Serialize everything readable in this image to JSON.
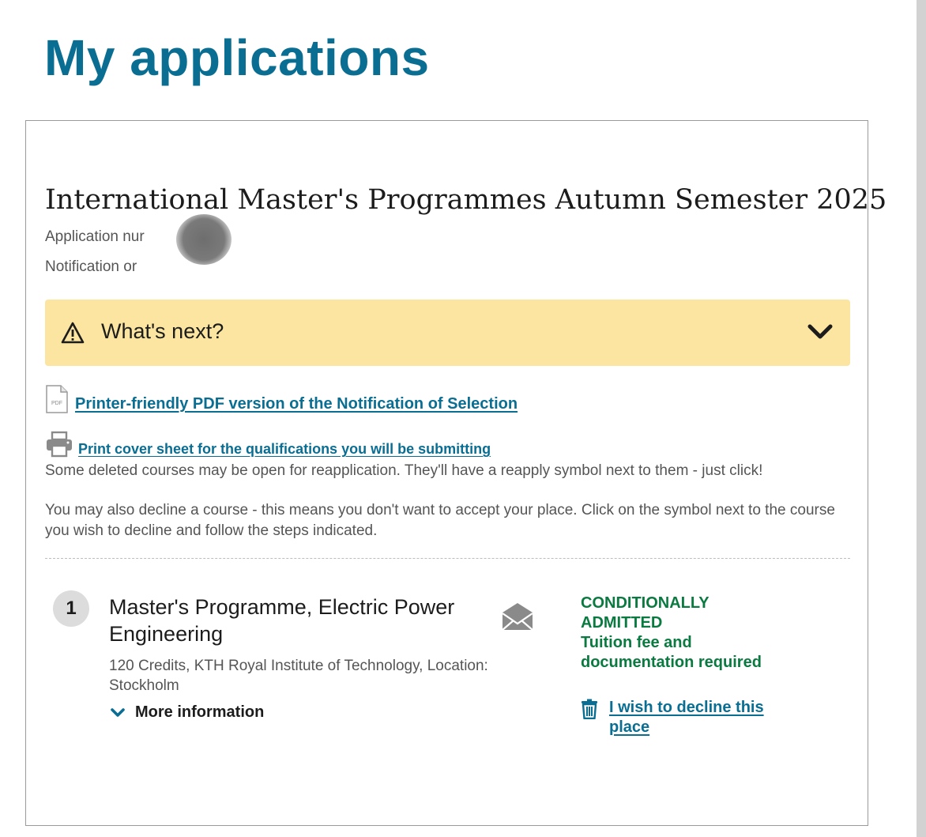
{
  "page": {
    "title": "My applications"
  },
  "application": {
    "round_title": "International Master's Programmes Autumn Semester 2025",
    "application_number_label": "Application nur",
    "notification_label": "Notification or",
    "whats_next": {
      "label": "What's next?",
      "expanded": false
    },
    "links": {
      "pdf_icon_text": "PDF",
      "pdf_link": "Printer-friendly PDF version of the Notification of Selection",
      "print_link": "Print cover sheet for the qualifications you will be submitting"
    },
    "info": {
      "reapply_text": "Some deleted courses may be open for reapplication. They'll have a reapply symbol next to them - just click!",
      "decline_text": "You may also decline a course - this means you don't want to accept your place. Click on the symbol next to the course you wish to decline and follow the steps indicated."
    },
    "courses": [
      {
        "number": "1",
        "title": "Master's Programme, Electric Power Engineering",
        "description": "120 Credits, KTH Royal Institute of Technology, Location: Stockholm",
        "more_info_label": "More information",
        "status": "CONDITIONALLY ADMITTED",
        "status_detail": "Tuition fee and documentation required",
        "decline_link": "I wish to decline this place"
      }
    ]
  },
  "colors": {
    "title_blue": "#0a6e93",
    "link_blue": "#0a6e93",
    "status_green": "#0a7a41",
    "notice_yellow": "#fbe5a0",
    "body_text": "#555555"
  }
}
